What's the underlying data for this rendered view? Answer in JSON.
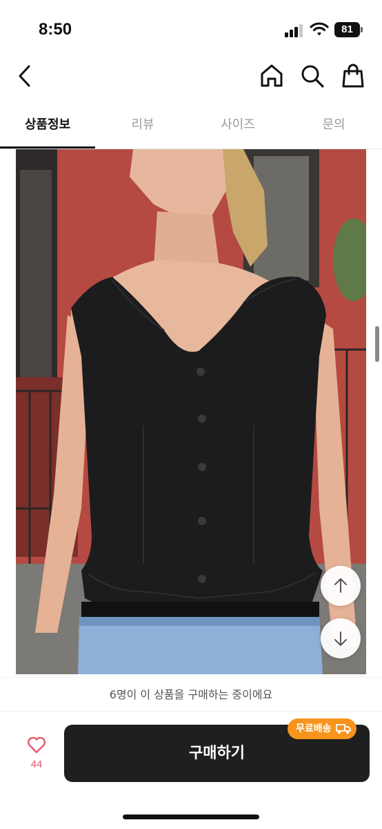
{
  "status_bar": {
    "time": "8:50",
    "battery": "81"
  },
  "nav": {
    "back_icon": "chevron-left-icon",
    "home_icon": "home-icon",
    "search_icon": "search-icon",
    "cart_icon": "shopping-bag-icon"
  },
  "tabs": [
    {
      "label": "상품정보",
      "active": true
    },
    {
      "label": "리뷰",
      "active": false
    },
    {
      "label": "사이즈",
      "active": false
    },
    {
      "label": "문의",
      "active": false
    }
  ],
  "product_image": {
    "description_icon": "product-photo"
  },
  "scroll_buttons": {
    "up_icon": "arrow-up-icon",
    "down_icon": "arrow-down-icon"
  },
  "footer": {
    "buyers_notice": "6명이 이 상품을 구매하는 중이에요",
    "like_count": "44",
    "buy_label": "구매하기",
    "badge_label": "무료배송",
    "badge_color": "#f7941d",
    "like_color": "#e5586b"
  }
}
